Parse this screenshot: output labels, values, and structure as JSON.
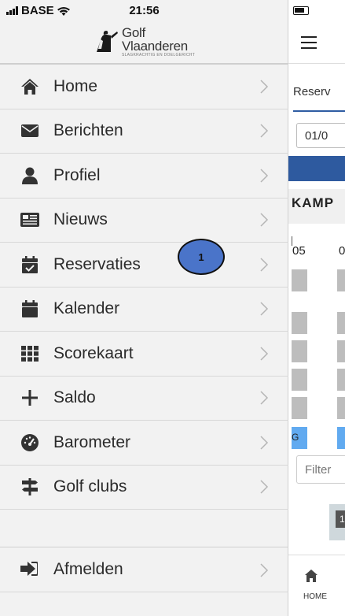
{
  "status": {
    "carrier": "BASE",
    "time": "21:56"
  },
  "brand": {
    "line1": "Golf",
    "line2": "Vlaanderen",
    "tagline": "SLAGKRACHTIG EN DOELGERICHT"
  },
  "menu": [
    {
      "label": "Home",
      "icon": "home-icon"
    },
    {
      "label": "Berichten",
      "icon": "envelope-icon"
    },
    {
      "label": "Profiel",
      "icon": "user-icon"
    },
    {
      "label": "Nieuws",
      "icon": "newspaper-icon"
    },
    {
      "label": "Reservaties",
      "icon": "calendar-check-icon"
    },
    {
      "label": "Kalender",
      "icon": "calendar-icon"
    },
    {
      "label": "Scorekaart",
      "icon": "grid-icon"
    },
    {
      "label": "Saldo",
      "icon": "plus-icon"
    },
    {
      "label": "Barometer",
      "icon": "tachometer-icon"
    },
    {
      "label": "Golf clubs",
      "icon": "signpost-icon"
    }
  ],
  "logout": {
    "label": "Afmelden",
    "icon": "sign-out-icon"
  },
  "annotation": {
    "number": "1"
  },
  "background_app": {
    "tab_label": "Reserv",
    "date_value": "01/0",
    "course_label": "KAMP",
    "hour_1": "05",
    "hour_2": "0",
    "slot_text": "G",
    "filter_placeholder": "Filter",
    "thumb_badge": "1",
    "nav_home": "HOME"
  },
  "colors": {
    "drawer_bg": "#f2f2f2",
    "accent_blue": "#2e5a9f",
    "slot_gray": "#bdbdbd",
    "slot_blue": "#61aaf0",
    "marker_blue": "#4a74c9"
  }
}
